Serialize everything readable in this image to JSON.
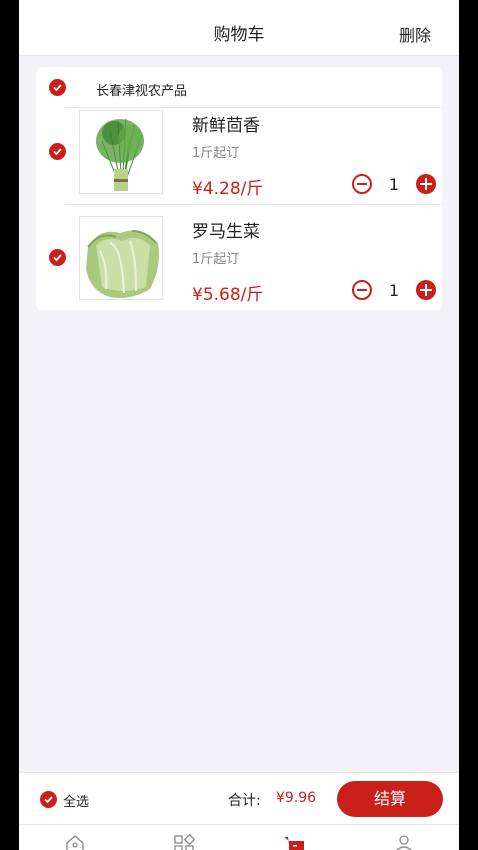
{
  "header": {
    "title": "购物车",
    "delete_label": "删除"
  },
  "store": {
    "name": "长春津视农产品"
  },
  "items": [
    {
      "name": "新鲜茴香",
      "min_order": "1斤起订",
      "price": "¥4.28/斤",
      "quantity": "1"
    },
    {
      "name": "罗马生菜",
      "min_order": "1斤起订",
      "price": "¥5.68/斤",
      "quantity": "1"
    }
  ],
  "footer": {
    "select_all_label": "全选",
    "total_label": "合计:",
    "total_value": "¥9.96",
    "checkout_label": "结算"
  },
  "tabbar": {
    "icons": [
      "home-icon",
      "category-icon",
      "cart-icon",
      "user-icon"
    ]
  },
  "colors": {
    "accent": "#c9201a",
    "background": "#f3f3f7"
  }
}
